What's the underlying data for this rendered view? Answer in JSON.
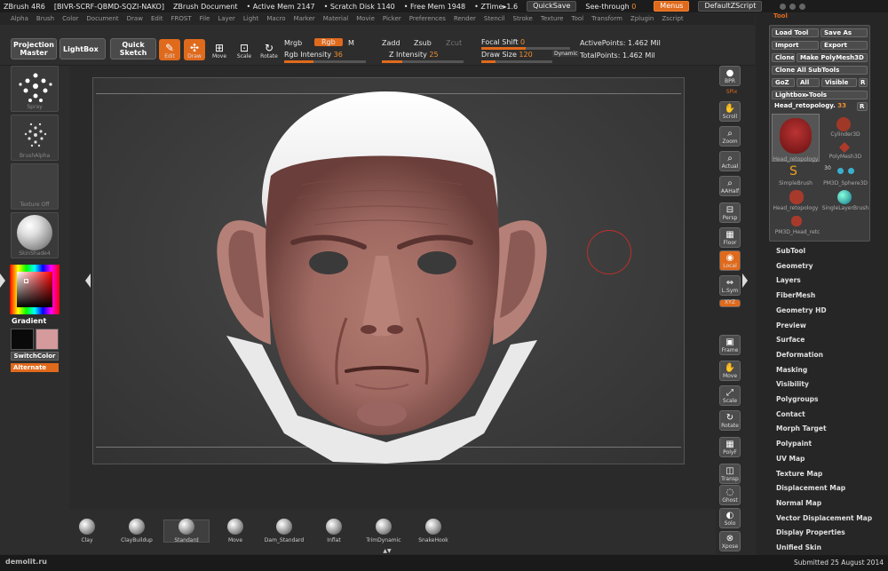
{
  "titlebar": {
    "app": "ZBrush  4R6",
    "key": "[BIVR-SCRF-QBMD-SQZI-NAKO]",
    "doc": "ZBrush Document",
    "active_mem": "• Active Mem 2147",
    "scratch": "• Scratch Disk 1140",
    "free_mem": "• Free Mem 1948",
    "ztime": "• ZTime▸1.6",
    "quicksave": "QuickSave",
    "seethrough": "See-through",
    "seethrough_val": "0",
    "menus": "Menus",
    "script": "DefaultZScript"
  },
  "menubar": [
    "Alpha",
    "Brush",
    "Color",
    "Document",
    "Draw",
    "Edit",
    "FROST",
    "File",
    "Layer",
    "Light",
    "Macro",
    "Marker",
    "Material",
    "Movie",
    "Picker",
    "Preferences",
    "Render",
    "Stencil",
    "Stroke",
    "Texture",
    "Tool",
    "Transform",
    "Zplugin",
    "Zscript"
  ],
  "toolbar": {
    "projection": "Projection\nMaster",
    "lightbox": "LightBox",
    "quicksketch": "Quick\nSketch",
    "edit": "Edit",
    "draw": "Draw",
    "move": "Move",
    "scale": "Scale",
    "rotate": "Rotate",
    "mrgb": "Mrgb",
    "rgb": "Rgb",
    "m": "M",
    "rgb_intensity": "Rgb Intensity",
    "rgb_intensity_val": "36",
    "zadd": "Zadd",
    "zsub": "Zsub",
    "zcut": "Zcut",
    "z_intensity": "Z Intensity",
    "z_intensity_val": "25",
    "focal_shift": "Focal Shift",
    "focal_shift_val": "0",
    "draw_size": "Draw Size",
    "draw_size_val": "120",
    "dynamic": "Dynamic",
    "active_points": "ActivePoints: 1.462  Mil",
    "total_points": "TotalPoints: 1.462  Mil"
  },
  "leftpanel": {
    "spray": "Spray",
    "brushalpha": "BrushAlpha",
    "texture": "Texture Off",
    "material": "SkinShade4",
    "gradient": "Gradient",
    "switchcolor": "SwitchColor",
    "alternate": "Alternate",
    "color_main": "#0a0a0a",
    "color_secondary": "#d49a9c"
  },
  "rightstrip": [
    {
      "label": "BPR",
      "icon": "bpr-icon"
    },
    {
      "label": "SPix",
      "text": true
    },
    {
      "label": "Scroll",
      "icon": "hand-icon"
    },
    {
      "label": "Zoom",
      "icon": "magnifier-icon"
    },
    {
      "label": "Actual",
      "icon": "magnifier-icon"
    },
    {
      "label": "AAHalf",
      "icon": "magnifier-icon"
    },
    {
      "label": "Persp",
      "icon": "persp-icon"
    },
    {
      "label": "Floor",
      "icon": "floor-icon"
    },
    {
      "label": "Local",
      "icon": "local-icon",
      "active": true
    },
    {
      "label": "L.Sym",
      "icon": "lsym-icon"
    },
    {
      "label": "XYZ",
      "active": true
    },
    {
      "label": "Frame",
      "icon": "frame-icon"
    },
    {
      "label": "Move",
      "icon": "hand-icon"
    },
    {
      "label": "Scale",
      "icon": "scale-icon"
    },
    {
      "label": "Rotate",
      "icon": "rotate-icon"
    },
    {
      "label": "PolyF",
      "icon": "grid-icon"
    },
    {
      "label": "Transp",
      "icon": "transp-icon"
    },
    {
      "label": "Ghost",
      "icon": "ghost-icon"
    },
    {
      "label": "Solo",
      "icon": "solo-icon"
    },
    {
      "label": "Xpose",
      "icon": "xpose-icon"
    }
  ],
  "toolpanel": {
    "title": "Tool",
    "load": "Load Tool",
    "save": "Save As",
    "import": "Import",
    "export": "Export",
    "clone": "Clone",
    "make_polymesh": "Make PolyMesh3D",
    "clone_all": "Clone All SubTools",
    "goz": "GoZ",
    "all": "All",
    "visible": "Visible",
    "r": "R",
    "lightbox_tools": "Lightbox▸Tools",
    "current_tool": "Head_retopology.",
    "current_tool_val": "33",
    "r2": "R",
    "subtools": [
      "Head_retopology",
      "Cylinder3D",
      "PolyMesh3D",
      "SimpleBrush",
      "PM3D_Sphere3D",
      "Head_retopology",
      "SingleLayerBrush",
      "PM3D_Head_retc"
    ],
    "count30": "30"
  },
  "menulist": [
    "SubTool",
    "Geometry",
    "Layers",
    "FiberMesh",
    "Geometry HD",
    "Preview",
    "Surface",
    "Deformation",
    "Masking",
    "Visibility",
    "Polygroups",
    "Contact",
    "Morph Target",
    "Polypaint",
    "UV Map",
    "Texture Map",
    "Displacement Map",
    "Normal Map",
    "Vector Displacement Map",
    "Display Properties",
    "Unified Skin"
  ],
  "brushes": [
    "Clay",
    "ClayBuildup",
    "Standard",
    "Move",
    "Dam_Standard",
    "Inflat",
    "TrimDynamic",
    "SnakeHook"
  ],
  "footer": {
    "logo": "demolit.ru",
    "submitted": "Submitted 25 August 2014"
  }
}
